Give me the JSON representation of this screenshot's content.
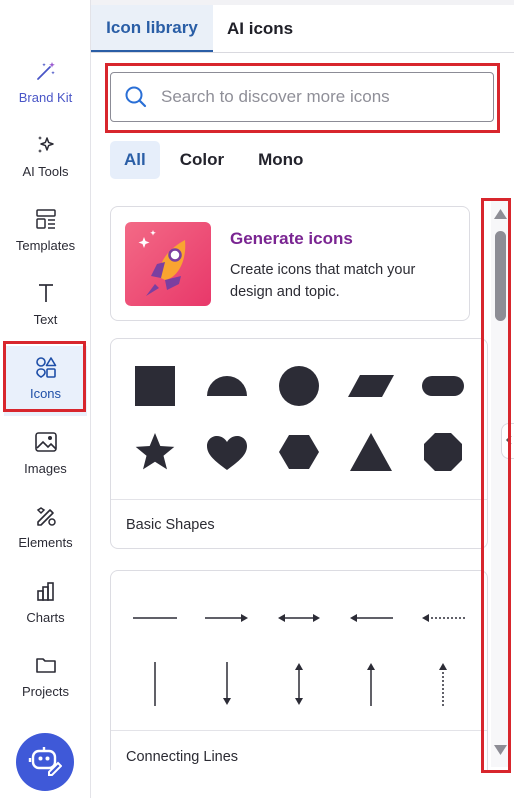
{
  "rail": {
    "items": [
      {
        "label": "Brand Kit",
        "icon": "magic-wand-icon"
      },
      {
        "label": "AI Tools",
        "icon": "sparkles-icon"
      },
      {
        "label": "Templates",
        "icon": "templates-icon"
      },
      {
        "label": "Text",
        "icon": "text-icon"
      },
      {
        "label": "Icons",
        "icon": "shapes-icon"
      },
      {
        "label": "Images",
        "icon": "image-icon"
      },
      {
        "label": "Elements",
        "icon": "elements-icon"
      },
      {
        "label": "Charts",
        "icon": "bar-chart-icon"
      },
      {
        "label": "Projects",
        "icon": "folder-icon"
      }
    ],
    "active": "Icons",
    "assistant_icon": "ai-assistant-bot-icon"
  },
  "tabs": [
    {
      "label": "Icon library",
      "selected": true
    },
    {
      "label": "AI icons",
      "selected": false
    }
  ],
  "search": {
    "placeholder": "Search to discover more icons",
    "value": ""
  },
  "filters": [
    {
      "label": "All",
      "selected": true
    },
    {
      "label": "Color",
      "selected": false
    },
    {
      "label": "Mono",
      "selected": false
    }
  ],
  "generate_card": {
    "title": "Generate icons",
    "description": "Create icons that match your design and topic.",
    "icon": "rocket-icon"
  },
  "sections": [
    {
      "label": "Basic Shapes",
      "items": [
        "square",
        "half-circle",
        "circle",
        "parallelogram",
        "pill",
        "star",
        "heart",
        "hexagon",
        "triangle",
        "octagon"
      ]
    },
    {
      "label": "Connecting Lines",
      "items": [
        "horizontal-line",
        "right-arrow",
        "double-arrow",
        "left-arrow",
        "dotted-left-arrow",
        "vertical-line",
        "down-arrow",
        "vertical-double-arrow",
        "up-arrow",
        "dotted-up-arrow"
      ]
    }
  ],
  "colors": {
    "accent": "#2a5ea6",
    "highlight_box": "#d8262d",
    "shape_fill": "#2c2c36",
    "generate_title": "#7a2592",
    "assistant_button": "#3f59d8"
  }
}
